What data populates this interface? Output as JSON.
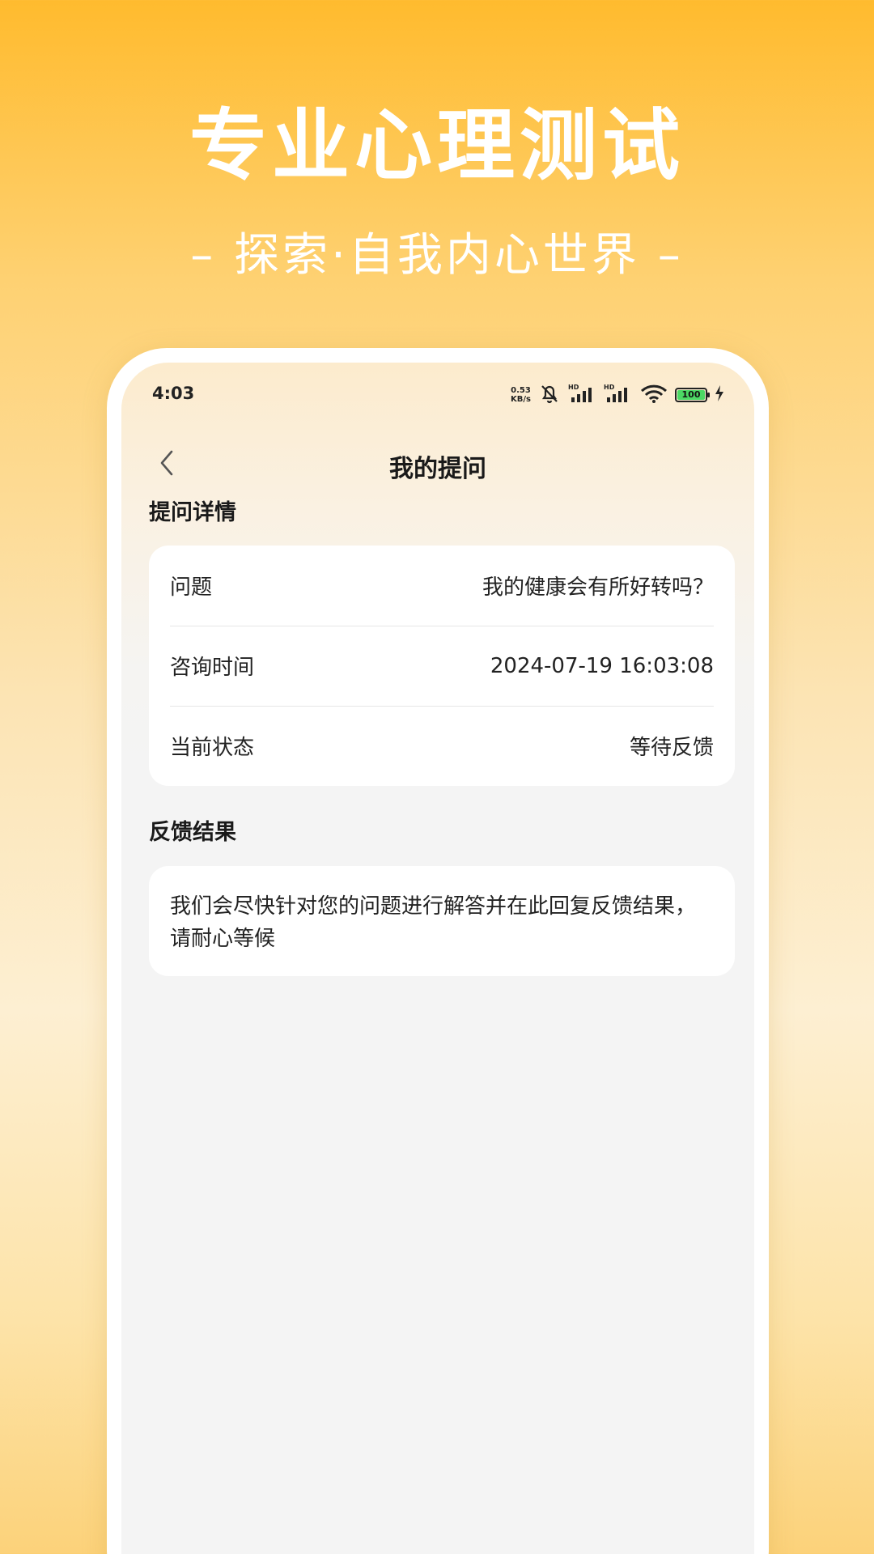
{
  "promo": {
    "title": "专业心理测试",
    "subtitle": "– 探索·自我内心世界 –"
  },
  "status_bar": {
    "time": "4:03",
    "net_speed_value": "0.53",
    "net_speed_unit": "KB/s",
    "battery_level": "100"
  },
  "nav": {
    "title": "我的提问"
  },
  "details_section": {
    "title": "提问详情",
    "rows": [
      {
        "label": "问题",
        "value": "我的健康会有所好转吗？"
      },
      {
        "label": "咨询时间",
        "value": "2024-07-19 16:03:08"
      },
      {
        "label": "当前状态",
        "value": "等待反馈"
      }
    ]
  },
  "feedback_section": {
    "title": "反馈结果",
    "message": "我们会尽快针对您的问题进行解答并在此回复反馈结果，请耐心等候"
  }
}
